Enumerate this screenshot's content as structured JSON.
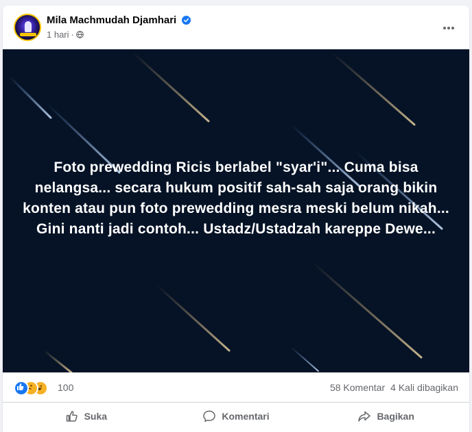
{
  "post": {
    "author": "Mila Machmudah Djamhari",
    "verified": true,
    "time": "1 hari",
    "dot": "·",
    "more_icon": "more-options-icon",
    "image_text": "Foto prewedding Ricis berlabel \"syar'i\"... Cuma bisa nelangsa... secara hukum positif sah-sah saja orang bikin konten atau pun foto prewedding mesra meski belum nikah... Gini nanti jadi contoh... Ustadz/Ustadzah kareppe Dewe...",
    "image_background": "#061326"
  },
  "stats": {
    "reaction_count": "100",
    "comments": "58 Komentar",
    "shares": "4 Kali dibagikan"
  },
  "actions": {
    "like": "Suka",
    "comment": "Komentari",
    "share": "Bagikan"
  },
  "colors": {
    "brand": "#1877f2",
    "secondary_text": "#65676b"
  }
}
